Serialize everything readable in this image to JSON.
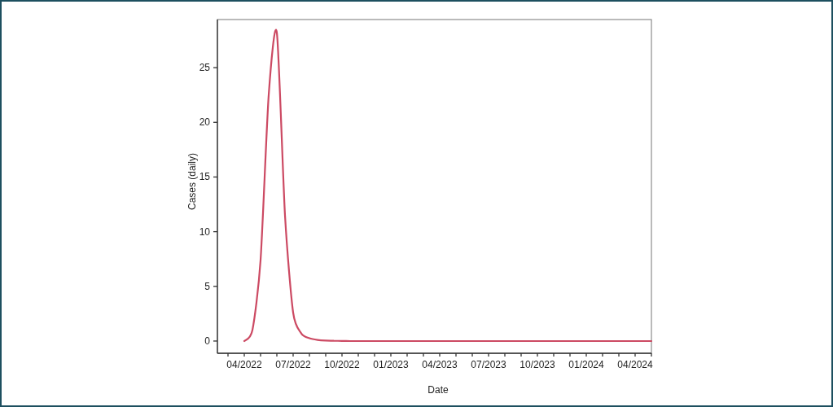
{
  "chart_data": {
    "type": "line",
    "xlabel": "Date",
    "ylabel": "Cases (daily)",
    "categories": [
      "04/2022",
      null,
      null,
      null,
      null,
      null,
      "07/2022",
      null,
      null,
      null,
      null,
      null,
      "10/2022",
      null,
      null,
      null,
      null,
      null,
      "01/2023",
      null,
      null,
      null,
      null,
      null,
      "04/2023",
      null,
      null,
      null,
      null,
      null,
      "07/2023",
      null,
      null,
      null,
      null,
      null,
      "10/2023",
      null,
      null,
      null,
      null,
      null,
      "01/2024",
      null,
      null,
      null,
      null,
      null,
      "04/2024",
      null,
      null
    ],
    "series": [
      {
        "color": "#cc4a63",
        "values": [
          0,
          1.0,
          7.4,
          22.5,
          28.2,
          11.5,
          2.6,
          0.7,
          0.25,
          0.1,
          0.04,
          0.02,
          0.01,
          0,
          0,
          0,
          0,
          0,
          0,
          0,
          0,
          0,
          0,
          0,
          0,
          0,
          0,
          0,
          0,
          0,
          0,
          0,
          0,
          0,
          0,
          0,
          0,
          0,
          0,
          0,
          0,
          0,
          0,
          0,
          0,
          0,
          0,
          0,
          0,
          0,
          0
        ]
      }
    ],
    "ylim": [
      -1.12,
      29.4
    ],
    "yticks": [
      0,
      5,
      10,
      15,
      20,
      25
    ]
  }
}
